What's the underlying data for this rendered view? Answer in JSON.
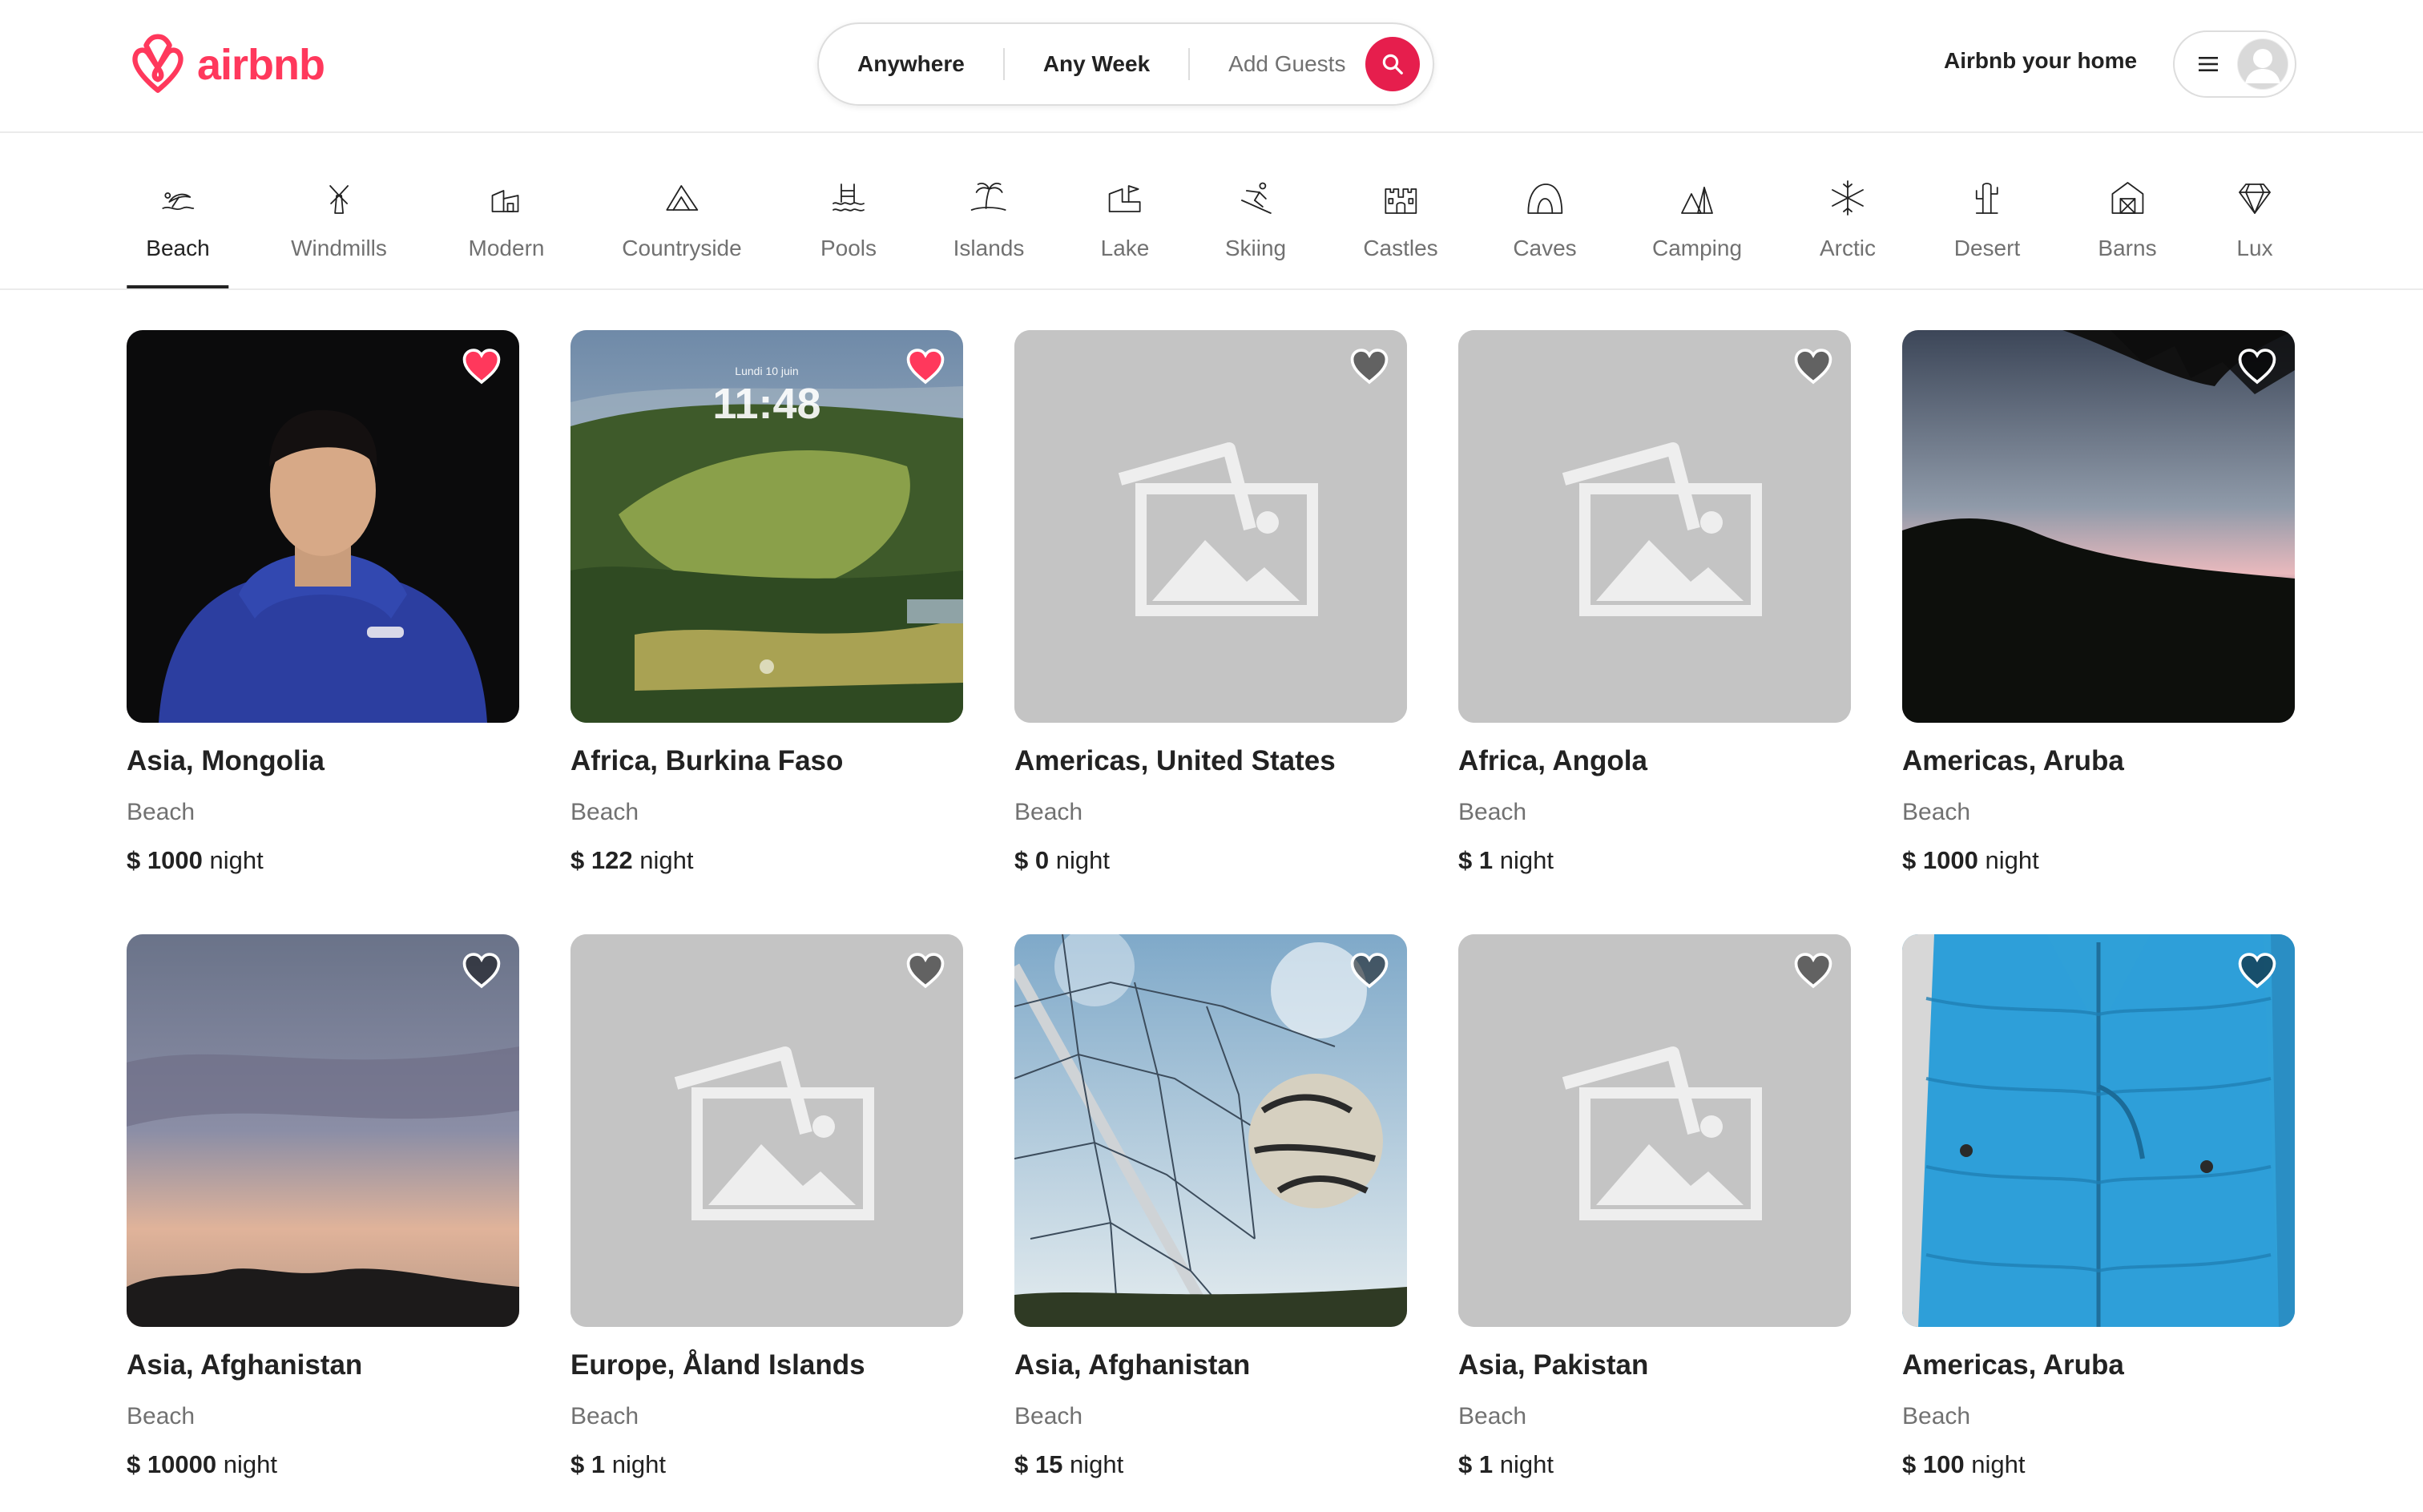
{
  "brand": {
    "name": "airbnb",
    "color": "#ff385c"
  },
  "search": {
    "where": "Anywhere",
    "when": "Any Week",
    "guests": "Add Guests",
    "button_color": "#e61e4d"
  },
  "host_link": "Airbnb your home",
  "categories": [
    {
      "label": "Beach",
      "icon": "beach-icon",
      "active": true
    },
    {
      "label": "Windmills",
      "icon": "windmill-icon"
    },
    {
      "label": "Modern",
      "icon": "modern-house-icon"
    },
    {
      "label": "Countryside",
      "icon": "mountain-icon"
    },
    {
      "label": "Pools",
      "icon": "pool-icon"
    },
    {
      "label": "Islands",
      "icon": "island-icon"
    },
    {
      "label": "Lake",
      "icon": "lake-icon"
    },
    {
      "label": "Skiing",
      "icon": "skiing-icon"
    },
    {
      "label": "Castles",
      "icon": "castle-icon"
    },
    {
      "label": "Caves",
      "icon": "cave-icon"
    },
    {
      "label": "Camping",
      "icon": "camping-icon"
    },
    {
      "label": "Arctic",
      "icon": "snowflake-icon"
    },
    {
      "label": "Desert",
      "icon": "cactus-icon"
    },
    {
      "label": "Barns",
      "icon": "barn-icon"
    },
    {
      "label": "Lux",
      "icon": "diamond-icon"
    }
  ],
  "listings": [
    {
      "title": "Asia, Mongolia",
      "type": "Beach",
      "currency": "$",
      "price": "1000",
      "unit": "night",
      "favorited": true,
      "photo": "portrait-photo"
    },
    {
      "title": "Africa, Burkina Faso",
      "type": "Beach",
      "currency": "$",
      "price": "122",
      "unit": "night",
      "favorited": true,
      "photo": "landscape-photo",
      "photo_text": {
        "date": "Lundi 10 juin",
        "time": "11:48"
      }
    },
    {
      "title": "Americas, United States",
      "type": "Beach",
      "currency": "$",
      "price": "0",
      "unit": "night",
      "favorited": false,
      "photo": "placeholder"
    },
    {
      "title": "Africa, Angola",
      "type": "Beach",
      "currency": "$",
      "price": "1",
      "unit": "night",
      "favorited": false,
      "photo": "placeholder"
    },
    {
      "title": "Americas, Aruba",
      "type": "Beach",
      "currency": "$",
      "price": "1000",
      "unit": "night",
      "favorited": false,
      "photo": "sunset-photo"
    },
    {
      "title": "Asia, Afghanistan",
      "type": "Beach",
      "currency": "$",
      "price": "10000",
      "unit": "night",
      "favorited": false,
      "photo": "sky-photo"
    },
    {
      "title": "Europe, Åland Islands",
      "type": "Beach",
      "currency": "$",
      "price": "1",
      "unit": "night",
      "favorited": false,
      "photo": "placeholder"
    },
    {
      "title": "Asia, Afghanistan",
      "type": "Beach",
      "currency": "$",
      "price": "15",
      "unit": "night",
      "favorited": false,
      "photo": "soccer-photo"
    },
    {
      "title": "Asia, Pakistan",
      "type": "Beach",
      "currency": "$",
      "price": "1",
      "unit": "night",
      "favorited": false,
      "photo": "placeholder"
    },
    {
      "title": "Americas, Aruba",
      "type": "Beach",
      "currency": "$",
      "price": "100",
      "unit": "night",
      "favorited": false,
      "photo": "jacket-photo"
    }
  ]
}
